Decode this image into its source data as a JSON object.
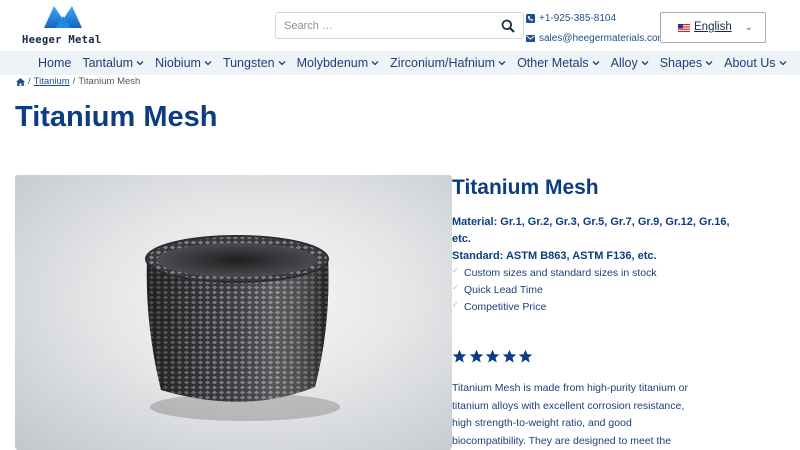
{
  "brand": {
    "name": "Heeger Metal",
    "accent": "#1d4f91",
    "title_color": "#0d3d80"
  },
  "search": {
    "placeholder": "Search …",
    "icon": "search-icon"
  },
  "contact": {
    "phone": "+1-925-385-8104",
    "email": "sales@heegermaterials.com",
    "phone_icon": "phone-icon",
    "email_icon": "envelope-icon"
  },
  "language": {
    "label": "English",
    "flag_icon": "us-flag-icon"
  },
  "nav": {
    "items": [
      {
        "label": "Home",
        "dropdown": false
      },
      {
        "label": "Tantalum",
        "dropdown": true
      },
      {
        "label": "Niobium",
        "dropdown": true
      },
      {
        "label": "Tungsten",
        "dropdown": true
      },
      {
        "label": "Molybdenum",
        "dropdown": true
      },
      {
        "label": "Zirconium/Hafnium",
        "dropdown": true
      },
      {
        "label": "Other Metals",
        "dropdown": true
      },
      {
        "label": "Alloy",
        "dropdown": true
      },
      {
        "label": "Shapes",
        "dropdown": true
      },
      {
        "label": "About Us",
        "dropdown": true
      }
    ]
  },
  "breadcrumb": {
    "home_icon": "home-icon",
    "sep": "/",
    "parent": "Titanium",
    "current": "Titanium Mesh"
  },
  "page": {
    "title": "Titanium Mesh"
  },
  "product": {
    "title": "Titanium Mesh",
    "material": "Material: Gr.1, Gr.2, Gr.3, Gr.5, Gr.7, Gr.9, Gr.12, Gr.16, etc.",
    "standard": "Standard: ASTM B863, ASTM F136, etc.",
    "features": [
      "Custom sizes and standard sizes in stock",
      "Quick Lead Time",
      "Competitive Price"
    ],
    "rating": 5,
    "description": "Titanium Mesh is made from high-purity titanium or\ntitanium alloys with excellent corrosion resistance,\nhigh strength-to-weight ratio, and good\nbiocompatibility. They are designed to meet the"
  }
}
